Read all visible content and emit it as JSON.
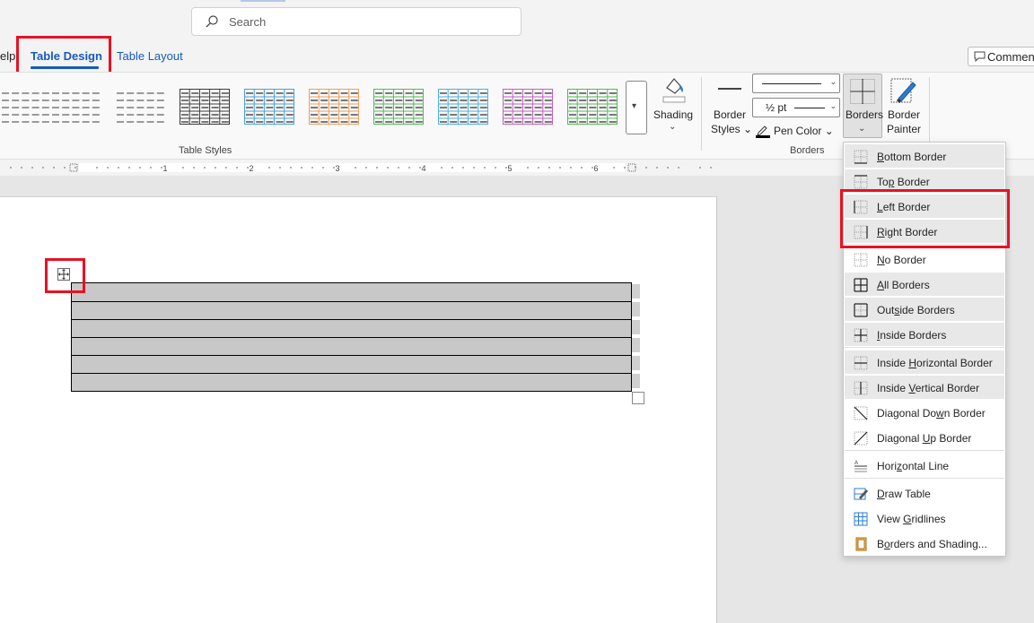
{
  "search": {
    "placeholder": "Search"
  },
  "tabs": {
    "help": "elp",
    "table_design": "Table Design",
    "table_layout": "Table Layout"
  },
  "comments_label": "Comments",
  "ribbon": {
    "table_styles_label": "Table Styles",
    "style_colors": [
      "#5a5a5a",
      "#5a5a5a",
      "#5a5a5a",
      "#3a3a3a",
      "#4a9fd8",
      "#e8a060",
      "#56b85a",
      "#4ab0e0",
      "#c060c0",
      "#56b85a"
    ],
    "shading_label": "Shading",
    "border_styles_label_1": "Border",
    "border_styles_label_2": "Styles",
    "line_weight": "½ pt",
    "pen_color_label": "Pen Color",
    "borders_label": "Borders",
    "borders_group_label": "Borders",
    "painter_label_1": "Border",
    "painter_label_2": "Painter"
  },
  "ruler": {
    "numbers": [
      "1",
      "2",
      "3",
      "4",
      "5",
      "6"
    ]
  },
  "table": {
    "rows": 6
  },
  "borders_menu": {
    "items": [
      {
        "label": "Bottom Border",
        "mnemonic": "B",
        "icon": "bottom-border-icon"
      },
      {
        "label": "Top Border",
        "mnemonic": "P",
        "icon": "top-border-icon"
      },
      {
        "label": "Left Border",
        "mnemonic": "L",
        "icon": "left-border-icon"
      },
      {
        "label": "Right Border",
        "mnemonic": "R",
        "icon": "right-border-icon"
      },
      {
        "label": "No Border",
        "mnemonic": "N",
        "icon": "no-border-icon"
      },
      {
        "label": "All Borders",
        "mnemonic": "A",
        "icon": "all-borders-icon"
      },
      {
        "label": "Outside Borders",
        "mnemonic": "S",
        "icon": "outside-borders-icon"
      },
      {
        "label": "Inside Borders",
        "mnemonic": "I",
        "icon": "inside-borders-icon"
      },
      {
        "label": "Inside Horizontal Border",
        "mnemonic": "H",
        "icon": "inside-horizontal-border-icon"
      },
      {
        "label": "Inside Vertical Border",
        "mnemonic": "V",
        "icon": "inside-vertical-border-icon"
      },
      {
        "label": "Diagonal Down Border",
        "mnemonic": "W",
        "icon": "diagonal-down-border-icon"
      },
      {
        "label": "Diagonal Up Border",
        "mnemonic": "U",
        "icon": "diagonal-up-border-icon"
      },
      {
        "label": "Horizontal Line",
        "mnemonic": "Z",
        "icon": "horizontal-line-icon"
      },
      {
        "label": "Draw Table",
        "mnemonic": "D",
        "icon": "draw-table-icon"
      },
      {
        "label": "View Gridlines",
        "mnemonic": "G",
        "icon": "view-gridlines-icon"
      },
      {
        "label": "Borders and Shading...",
        "mnemonic": "O",
        "icon": "borders-and-shading-icon"
      }
    ]
  },
  "colors": {
    "accent": "#185abd",
    "highlight_box": "#e81123"
  }
}
